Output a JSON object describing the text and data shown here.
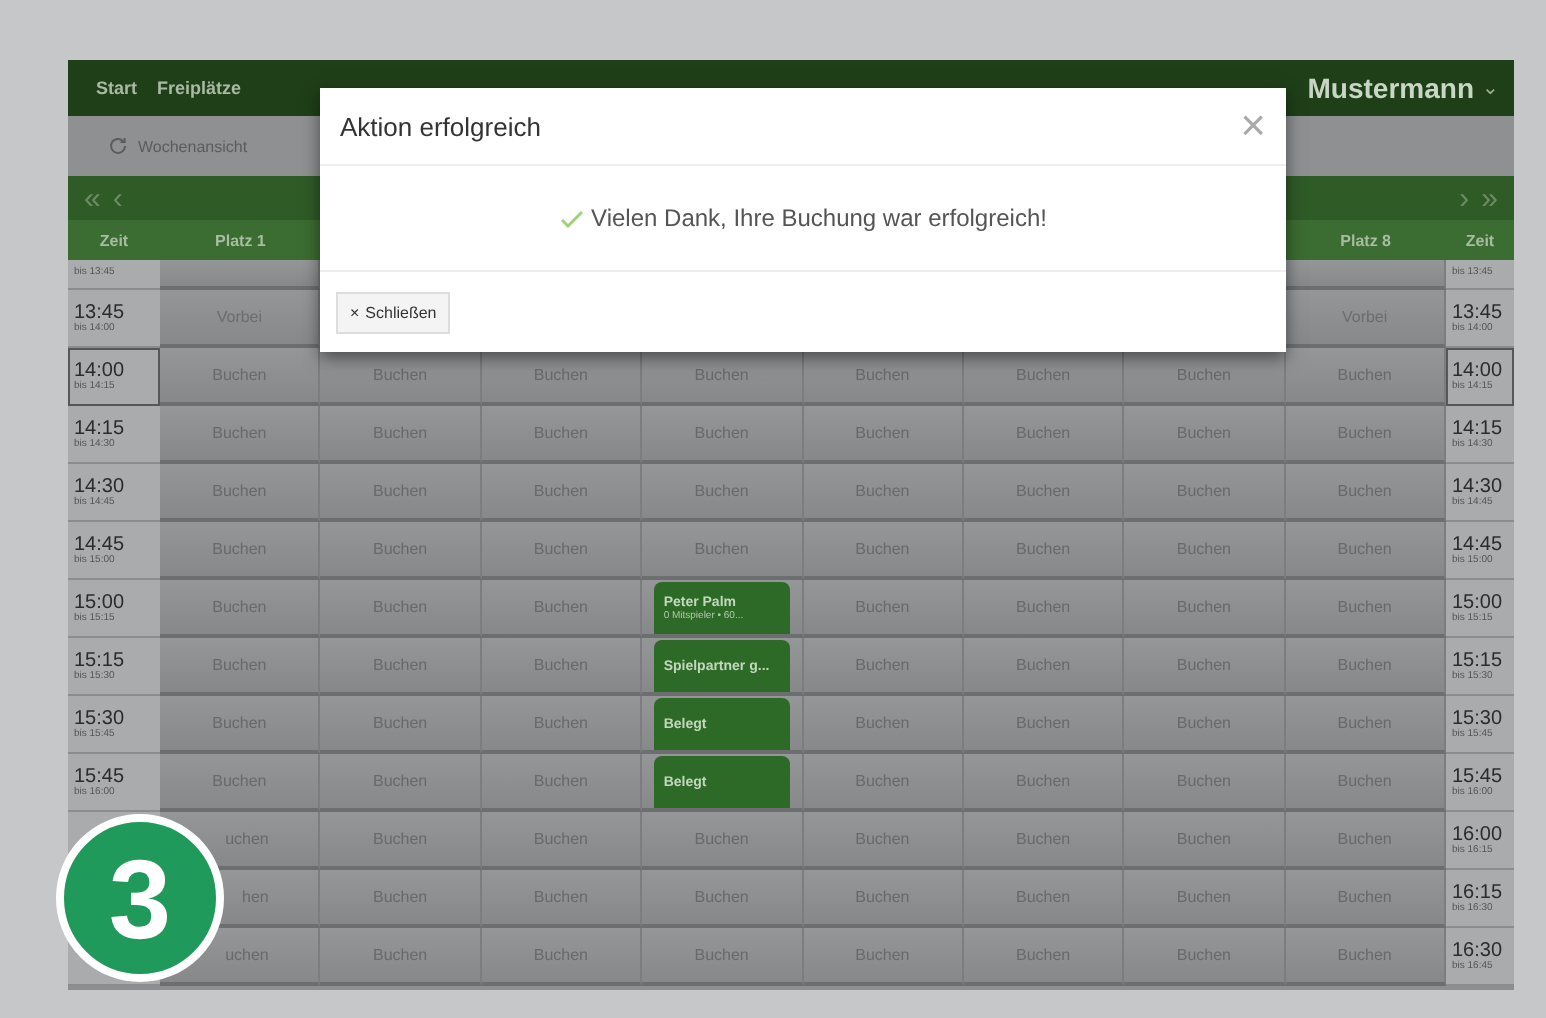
{
  "top_bar": {
    "links": [
      {
        "label": "Start"
      },
      {
        "label": "Freiplätze"
      }
    ],
    "user": {
      "name": "Mustermann",
      "caret": "⌄"
    }
  },
  "toolbar": {
    "view_button": "Wochenansicht"
  },
  "date_nav": {
    "prev": [
      "«",
      "‹"
    ],
    "next": [
      "›",
      "»"
    ]
  },
  "grid": {
    "time_header_left": "Zeit",
    "columns": [
      {
        "kind": "court",
        "label": "Platz 1"
      },
      {
        "kind": "covered"
      },
      {
        "kind": "covered"
      },
      {
        "kind": "covered"
      },
      {
        "kind": "covered"
      },
      {
        "kind": "covered"
      },
      {
        "kind": "covered"
      },
      {
        "kind": "court",
        "label": "Platz 8"
      }
    ],
    "time_header_right": "Zeit",
    "partial_row": {
      "until": "bis 13:45",
      "until_right": "bis 13:45"
    },
    "rows": [
      {
        "time": "13:45",
        "until": "bis 14:00",
        "current": false,
        "time_right": "13:45",
        "until_right": "bis 14:00",
        "cells": [
          {
            "kind": "past",
            "label": "Vorbei"
          },
          {
            "kind": "covered"
          },
          {
            "kind": "covered"
          },
          {
            "kind": "covered"
          },
          {
            "kind": "covered"
          },
          {
            "kind": "covered"
          },
          {
            "kind": "covered"
          },
          {
            "kind": "past",
            "label": "Vorbei"
          }
        ]
      },
      {
        "time": "14:00",
        "until": "bis 14:15",
        "current": true,
        "time_right": "14:00",
        "until_right": "bis 14:15",
        "cells": [
          {
            "kind": "free",
            "label": "Buchen"
          },
          {
            "kind": "free",
            "label": "Buchen"
          },
          {
            "kind": "free",
            "label": "Buchen"
          },
          {
            "kind": "free",
            "label": "Buchen"
          },
          {
            "kind": "free",
            "label": "Buchen"
          },
          {
            "kind": "free",
            "label": "Buchen"
          },
          {
            "kind": "free",
            "label": "Buchen"
          },
          {
            "kind": "free",
            "label": "Buchen"
          }
        ]
      },
      {
        "time": "14:15",
        "until": "bis 14:30",
        "current": false,
        "time_right": "14:15",
        "until_right": "bis 14:30",
        "cells": [
          {
            "kind": "free",
            "label": "Buchen"
          },
          {
            "kind": "free",
            "label": "Buchen"
          },
          {
            "kind": "free",
            "label": "Buchen"
          },
          {
            "kind": "free",
            "label": "Buchen"
          },
          {
            "kind": "free",
            "label": "Buchen"
          },
          {
            "kind": "free",
            "label": "Buchen"
          },
          {
            "kind": "free",
            "label": "Buchen"
          },
          {
            "kind": "free",
            "label": "Buchen"
          }
        ]
      },
      {
        "time": "14:30",
        "until": "bis 14:45",
        "current": false,
        "time_right": "14:30",
        "until_right": "bis 14:45",
        "cells": [
          {
            "kind": "free",
            "label": "Buchen"
          },
          {
            "kind": "free",
            "label": "Buchen"
          },
          {
            "kind": "free",
            "label": "Buchen"
          },
          {
            "kind": "free",
            "label": "Buchen"
          },
          {
            "kind": "free",
            "label": "Buchen"
          },
          {
            "kind": "free",
            "label": "Buchen"
          },
          {
            "kind": "free",
            "label": "Buchen"
          },
          {
            "kind": "free",
            "label": "Buchen"
          }
        ]
      },
      {
        "time": "14:45",
        "until": "bis 15:00",
        "current": false,
        "time_right": "14:45",
        "until_right": "bis 15:00",
        "cells": [
          {
            "kind": "free",
            "label": "Buchen"
          },
          {
            "kind": "free",
            "label": "Buchen"
          },
          {
            "kind": "free",
            "label": "Buchen"
          },
          {
            "kind": "free",
            "label": "Buchen"
          },
          {
            "kind": "free",
            "label": "Buchen"
          },
          {
            "kind": "free",
            "label": "Buchen"
          },
          {
            "kind": "free",
            "label": "Buchen"
          },
          {
            "kind": "free",
            "label": "Buchen"
          }
        ]
      },
      {
        "time": "15:00",
        "until": "bis 15:15",
        "current": false,
        "time_right": "15:00",
        "until_right": "bis 15:15",
        "cells": [
          {
            "kind": "free",
            "label": "Buchen"
          },
          {
            "kind": "free",
            "label": "Buchen"
          },
          {
            "kind": "free",
            "label": "Buchen"
          },
          {
            "kind": "booked",
            "label": "Peter Palm",
            "detail": "0 Mitspieler • 60..."
          },
          {
            "kind": "free",
            "label": "Buchen"
          },
          {
            "kind": "free",
            "label": "Buchen"
          },
          {
            "kind": "free",
            "label": "Buchen"
          },
          {
            "kind": "free",
            "label": "Buchen"
          }
        ]
      },
      {
        "time": "15:15",
        "until": "bis 15:30",
        "current": false,
        "time_right": "15:15",
        "until_right": "bis 15:30",
        "cells": [
          {
            "kind": "free",
            "label": "Buchen"
          },
          {
            "kind": "free",
            "label": "Buchen"
          },
          {
            "kind": "free",
            "label": "Buchen"
          },
          {
            "kind": "booked",
            "label": "Spielpartner g..."
          },
          {
            "kind": "free",
            "label": "Buchen"
          },
          {
            "kind": "free",
            "label": "Buchen"
          },
          {
            "kind": "free",
            "label": "Buchen"
          },
          {
            "kind": "free",
            "label": "Buchen"
          }
        ]
      },
      {
        "time": "15:30",
        "until": "bis 15:45",
        "current": false,
        "time_right": "15:30",
        "until_right": "bis 15:45",
        "cells": [
          {
            "kind": "free",
            "label": "Buchen"
          },
          {
            "kind": "free",
            "label": "Buchen"
          },
          {
            "kind": "free",
            "label": "Buchen"
          },
          {
            "kind": "booked",
            "label": "Belegt"
          },
          {
            "kind": "free",
            "label": "Buchen"
          },
          {
            "kind": "free",
            "label": "Buchen"
          },
          {
            "kind": "free",
            "label": "Buchen"
          },
          {
            "kind": "free",
            "label": "Buchen"
          }
        ]
      },
      {
        "time": "15:45",
        "until": "bis 16:00",
        "current": false,
        "time_right": "15:45",
        "until_right": "bis 16:00",
        "cells": [
          {
            "kind": "free",
            "label": "Buchen"
          },
          {
            "kind": "free",
            "label": "Buchen"
          },
          {
            "kind": "free",
            "label": "Buchen"
          },
          {
            "kind": "booked",
            "label": "Belegt"
          },
          {
            "kind": "free",
            "label": "Buchen"
          },
          {
            "kind": "free",
            "label": "Buchen"
          },
          {
            "kind": "free",
            "label": "Buchen"
          },
          {
            "kind": "free",
            "label": "Buchen"
          }
        ]
      },
      {
        "current": false,
        "time_right": "16:00",
        "until_right": "bis 16:15",
        "cells": [
          {
            "kind": "partial",
            "label": "uchen"
          },
          {
            "kind": "free",
            "label": "Buchen"
          },
          {
            "kind": "free",
            "label": "Buchen"
          },
          {
            "kind": "free",
            "label": "Buchen"
          },
          {
            "kind": "free",
            "label": "Buchen"
          },
          {
            "kind": "free",
            "label": "Buchen"
          },
          {
            "kind": "free",
            "label": "Buchen"
          },
          {
            "kind": "free",
            "label": "Buchen"
          }
        ]
      },
      {
        "current": false,
        "time_right": "16:15",
        "until_right": "bis 16:30",
        "cells": [
          {
            "kind": "partial",
            "label": "hen"
          },
          {
            "kind": "free",
            "label": "Buchen"
          },
          {
            "kind": "free",
            "label": "Buchen"
          },
          {
            "kind": "free",
            "label": "Buchen"
          },
          {
            "kind": "free",
            "label": "Buchen"
          },
          {
            "kind": "free",
            "label": "Buchen"
          },
          {
            "kind": "free",
            "label": "Buchen"
          },
          {
            "kind": "free",
            "label": "Buchen"
          }
        ]
      },
      {
        "current": false,
        "time_right": "16:30",
        "until_right": "bis 16:45",
        "cells": [
          {
            "kind": "partial",
            "label": "uchen"
          },
          {
            "kind": "free",
            "label": "Buchen"
          },
          {
            "kind": "free",
            "label": "Buchen"
          },
          {
            "kind": "free",
            "label": "Buchen"
          },
          {
            "kind": "free",
            "label": "Buchen"
          },
          {
            "kind": "free",
            "label": "Buchen"
          },
          {
            "kind": "free",
            "label": "Buchen"
          },
          {
            "kind": "free",
            "label": "Buchen"
          }
        ]
      }
    ]
  },
  "modal": {
    "title": "Aktion erfolgreich",
    "close": "×",
    "message": "Vielen Dank, Ihre Buchung war erfolgreich!",
    "button": {
      "icon": "×",
      "label": "Schließen"
    }
  },
  "step_badge": "3"
}
